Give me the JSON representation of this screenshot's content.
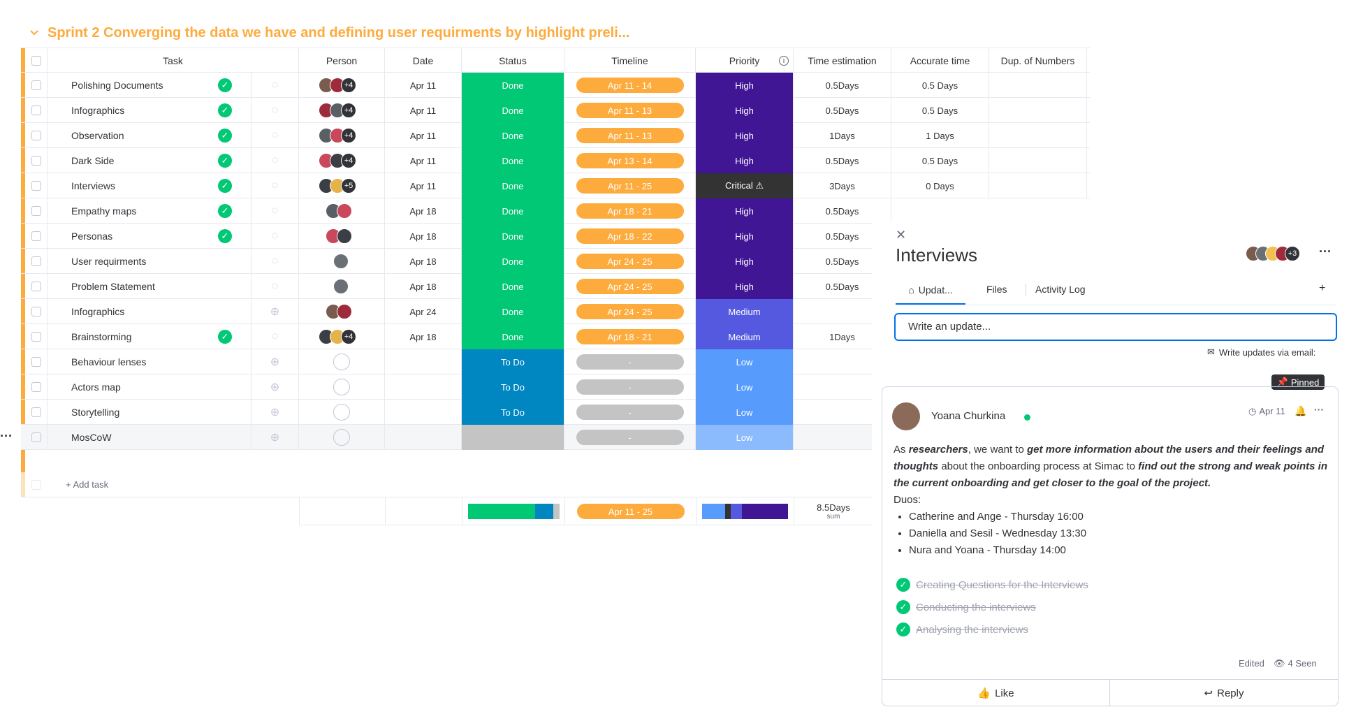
{
  "group": {
    "title": "Sprint 2 Converging the data we have and defining user requirments by highlight preli...",
    "color": "#fdab3d"
  },
  "columns": {
    "task": "Task",
    "person": "Person",
    "date": "Date",
    "status": "Status",
    "timeline": "Timeline",
    "priority": "Priority",
    "time_estimation": "Time estimation",
    "accurate_time": "Accurate time",
    "dup_numbers": "Dup. of Numbers"
  },
  "rows": [
    {
      "task": "Polishing Documents",
      "done": true,
      "date": "Apr 11",
      "status": "Done",
      "timeline": "Apr 11 - 14",
      "priority": "High",
      "time_est": "0.5Days",
      "accurate": "0.5 Days",
      "more": "+4"
    },
    {
      "task": "Infographics",
      "done": true,
      "date": "Apr 11",
      "status": "Done",
      "timeline": "Apr 11 - 13",
      "priority": "High",
      "time_est": "0.5Days",
      "accurate": "0.5 Days",
      "more": "+4"
    },
    {
      "task": "Observation",
      "done": true,
      "date": "Apr 11",
      "status": "Done",
      "timeline": "Apr 11 - 13",
      "priority": "High",
      "time_est": "1Days",
      "accurate": "1 Days",
      "more": "+4"
    },
    {
      "task": "Dark Side",
      "done": true,
      "date": "Apr 11",
      "status": "Done",
      "timeline": "Apr 13 - 14",
      "priority": "High",
      "time_est": "0.5Days",
      "accurate": "0.5 Days",
      "more": "+4"
    },
    {
      "task": "Interviews",
      "done": true,
      "date": "Apr 11",
      "status": "Done",
      "timeline": "Apr 11 - 25",
      "priority": "Critical ⚠",
      "time_est": "3Days",
      "accurate": "0 Days",
      "more": "+5"
    },
    {
      "task": "Empathy maps",
      "done": true,
      "date": "Apr 18",
      "status": "Done",
      "timeline": "Apr 18 - 21",
      "priority": "High",
      "time_est": "0.5Days",
      "accurate": "",
      "more": ""
    },
    {
      "task": "Personas",
      "done": true,
      "date": "Apr 18",
      "status": "Done",
      "timeline": "Apr 18 - 22",
      "priority": "High",
      "time_est": "0.5Days",
      "accurate": "",
      "more": ""
    },
    {
      "task": "User requirments",
      "done": false,
      "date": "Apr 18",
      "status": "Done",
      "timeline": "Apr 24 - 25",
      "priority": "High",
      "time_est": "0.5Days",
      "accurate": "",
      "more": ""
    },
    {
      "task": "Problem Statement",
      "done": false,
      "date": "Apr 18",
      "status": "Done",
      "timeline": "Apr 24 - 25",
      "priority": "High",
      "time_est": "0.5Days",
      "accurate": "",
      "more": ""
    },
    {
      "task": "Infographics",
      "done": false,
      "date": "Apr 24",
      "status": "Done",
      "timeline": "Apr 24 - 25",
      "priority": "Medium",
      "time_est": "",
      "accurate": "",
      "more": ""
    },
    {
      "task": "Brainstorming",
      "done": true,
      "date": "Apr 18",
      "status": "Done",
      "timeline": "Apr 18 - 21",
      "priority": "Medium",
      "time_est": "1Days",
      "accurate": "",
      "more": "+4"
    },
    {
      "task": "Behaviour lenses",
      "done": false,
      "date": "",
      "status": "To Do",
      "timeline": "-",
      "priority": "Low",
      "time_est": "",
      "accurate": "",
      "more": ""
    },
    {
      "task": "Actors map",
      "done": false,
      "date": "",
      "status": "To Do",
      "timeline": "-",
      "priority": "Low",
      "time_est": "",
      "accurate": "",
      "more": ""
    },
    {
      "task": "Storytelling",
      "done": false,
      "date": "",
      "status": "To Do",
      "timeline": "-",
      "priority": "Low",
      "time_est": "",
      "accurate": "",
      "more": ""
    },
    {
      "task": "MosCoW",
      "done": false,
      "date": "",
      "status": "",
      "timeline": "-",
      "priority": "Low",
      "time_est": "",
      "accurate": "",
      "more": ""
    }
  ],
  "add_task": "+ Add task",
  "summary": {
    "timeline": "Apr 11 - 25",
    "time_est": "8.5Days",
    "time_est_label": "sum"
  },
  "colors": {
    "done": "#00c875",
    "todo": "#0086c0",
    "high": "#401694",
    "critical": "#333333",
    "medium": "#5559df",
    "low": "#579bfc",
    "timeline": "#fdab3d",
    "timeline_empty": "#c4c4c4"
  },
  "panel": {
    "title": "Interviews",
    "more_avatars": "+3",
    "tabs": [
      "Updat...",
      "Files",
      "Activity Log"
    ],
    "add_tab": "+",
    "write_placeholder": "Write an update...",
    "email_link": "Write updates via email:",
    "pinned": "Pinned",
    "post": {
      "author": "Yoana Churkina",
      "date": "Apr 11",
      "intro_1": "As ",
      "bold_1": "researchers",
      "intro_2": ", we want to ",
      "bold_2": "get more information about the users and their feelings and thoughts",
      "intro_3": " about the onboarding process at Simac to ",
      "bold_3": "find out the strong and weak points in the current onboarding and get closer to the goal of the project.",
      "duos_label": "Duos:",
      "duos": [
        "Catherine and Ange - Thursday 16:00",
        "Daniella and Sesil - Wednesday 13:30",
        "Nura and Yoana - Thursday 14:00"
      ],
      "checklist": [
        "Creating Questions for the Interviews",
        "Conducting the interviews",
        "Analysing the interviews"
      ],
      "edited": "Edited",
      "seen": "4 Seen",
      "like": "Like",
      "reply": "Reply"
    }
  },
  "left_dots": "···"
}
